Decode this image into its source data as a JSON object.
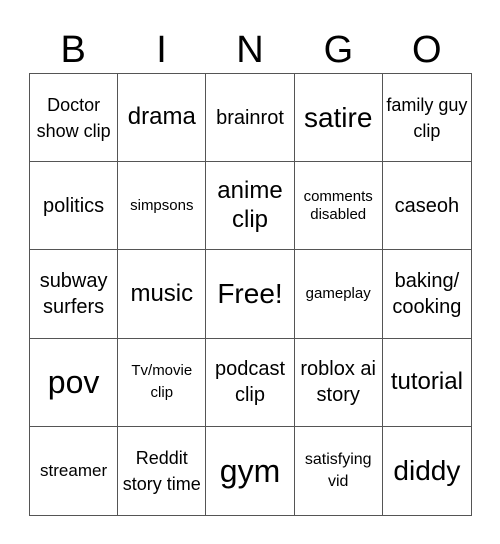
{
  "header": {
    "letters": [
      "B",
      "I",
      "N",
      "G",
      "O"
    ]
  },
  "cells": [
    "Doctor show clip",
    "drama",
    "brainrot",
    "satire",
    "family guy clip",
    "politics",
    "simpsons",
    "anime clip",
    "comments disabled",
    "caseoh",
    "subway surfers",
    "music",
    "Free!",
    "gameplay",
    "baking/ cooking",
    "pov",
    "Tv/movie clip",
    "podcast clip",
    "roblox ai story",
    "tutorial",
    "streamer",
    "Reddit story time",
    "gym",
    "satisfying vid",
    "diddy"
  ]
}
